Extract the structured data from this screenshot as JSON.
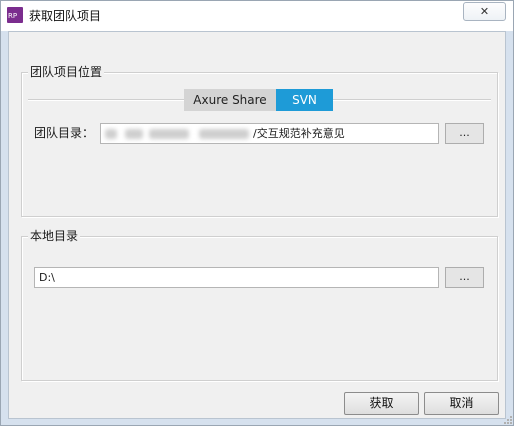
{
  "window": {
    "title": "获取团队项目",
    "app_icon_text": "RP",
    "close_glyph": "✕"
  },
  "team_project_location": {
    "group_title": "团队项目位置",
    "tabs": [
      {
        "label": "Axure Share",
        "selected": false
      },
      {
        "label": "SVN",
        "selected": true
      }
    ],
    "directory_label": "团队目录：",
    "directory_value_visible": "/交互规范补充意见",
    "browse_label": "..."
  },
  "local_directory": {
    "group_title": "本地目录",
    "value": "D:\\",
    "browse_label": "..."
  },
  "actions": {
    "fetch_label": "获取",
    "cancel_label": "取消"
  },
  "colors": {
    "svn_tab": "#1e9bd7",
    "axure_tab": "#d4d4d4",
    "app_icon": "#7b2d8e",
    "dialog_background": "#f0f0f0"
  }
}
